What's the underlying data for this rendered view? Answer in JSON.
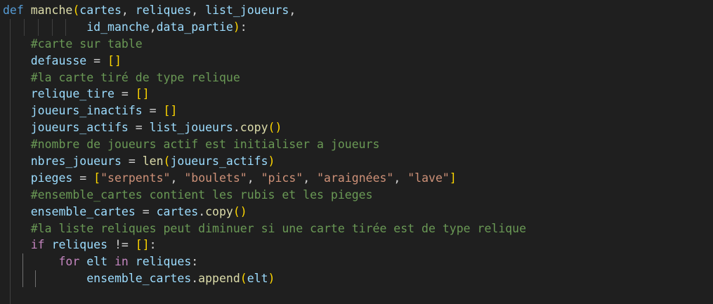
{
  "editor": {
    "background": "#1f1f1f",
    "colors": {
      "keyword_def": "#569cd6",
      "keyword_control": "#c586c0",
      "function": "#dcdcaa",
      "variable": "#9cdcfe",
      "comment": "#6a9955",
      "string": "#ce9178",
      "bracket_level1": "#ffd700",
      "bracket_level2": "#da70d6",
      "plain": "#d4d4d4"
    },
    "lines": [
      {
        "tokens": [
          [
            "kw-def",
            "def"
          ],
          [
            "plain",
            " "
          ],
          [
            "fn",
            "manche"
          ],
          [
            "b1",
            "("
          ],
          [
            "param",
            "cartes"
          ],
          [
            "plain",
            ", "
          ],
          [
            "param",
            "reliques"
          ],
          [
            "plain",
            ", "
          ],
          [
            "param",
            "list_joueurs"
          ],
          [
            "plain",
            ","
          ]
        ]
      },
      {
        "tokens": [
          [
            "plain",
            "            "
          ],
          [
            "param",
            "id_manche"
          ],
          [
            "plain",
            ","
          ],
          [
            "param",
            "data_partie"
          ],
          [
            "b1",
            ")"
          ],
          [
            "plain",
            ":"
          ]
        ]
      },
      {
        "tokens": [
          [
            "plain",
            "    "
          ],
          [
            "cmt",
            "#carte sur table"
          ]
        ]
      },
      {
        "tokens": [
          [
            "plain",
            "    "
          ],
          [
            "var",
            "defausse"
          ],
          [
            "plain",
            " = "
          ],
          [
            "b1",
            "[]"
          ]
        ]
      },
      {
        "tokens": [
          [
            "plain",
            "    "
          ],
          [
            "cmt",
            "#la carte tiré de type relique"
          ]
        ]
      },
      {
        "tokens": [
          [
            "plain",
            "    "
          ],
          [
            "var",
            "relique_tire"
          ],
          [
            "plain",
            " = "
          ],
          [
            "b1",
            "[]"
          ]
        ]
      },
      {
        "tokens": [
          [
            "plain",
            "    "
          ],
          [
            "var",
            "joueurs_inactifs"
          ],
          [
            "plain",
            " = "
          ],
          [
            "b1",
            "[]"
          ]
        ]
      },
      {
        "tokens": [
          [
            "plain",
            "    "
          ],
          [
            "var",
            "joueurs_actifs"
          ],
          [
            "plain",
            " = "
          ],
          [
            "var",
            "list_joueurs"
          ],
          [
            "plain",
            "."
          ],
          [
            "fn",
            "copy"
          ],
          [
            "b1",
            "()"
          ]
        ]
      },
      {
        "tokens": [
          [
            "plain",
            "    "
          ],
          [
            "cmt",
            "#nombre de joueurs actif est initialiser a joueurs"
          ]
        ]
      },
      {
        "tokens": [
          [
            "plain",
            "    "
          ],
          [
            "var",
            "nbres_joueurs"
          ],
          [
            "plain",
            " = "
          ],
          [
            "fn",
            "len"
          ],
          [
            "b1",
            "("
          ],
          [
            "var",
            "joueurs_actifs"
          ],
          [
            "b1",
            ")"
          ]
        ]
      },
      {
        "tokens": [
          [
            "plain",
            "    "
          ],
          [
            "var",
            "pieges"
          ],
          [
            "plain",
            " = "
          ],
          [
            "b1",
            "["
          ],
          [
            "str",
            "\"serpents\""
          ],
          [
            "plain",
            ", "
          ],
          [
            "str",
            "\"boulets\""
          ],
          [
            "plain",
            ", "
          ],
          [
            "str",
            "\"pics\""
          ],
          [
            "plain",
            ", "
          ],
          [
            "str",
            "\"araignées\""
          ],
          [
            "plain",
            ", "
          ],
          [
            "str",
            "\"lave\""
          ],
          [
            "b1",
            "]"
          ]
        ]
      },
      {
        "tokens": [
          [
            "plain",
            "    "
          ],
          [
            "cmt",
            "#ensemble_cartes contient les rubis et les pieges"
          ]
        ]
      },
      {
        "tokens": [
          [
            "plain",
            "    "
          ],
          [
            "var",
            "ensemble_cartes"
          ],
          [
            "plain",
            " = "
          ],
          [
            "var",
            "cartes"
          ],
          [
            "plain",
            "."
          ],
          [
            "fn",
            "copy"
          ],
          [
            "b1",
            "()"
          ]
        ]
      },
      {
        "tokens": [
          [
            "plain",
            "    "
          ],
          [
            "cmt",
            "#la liste reliques peut diminuer si une carte tirée est de type relique"
          ]
        ]
      },
      {
        "tokens": [
          [
            "plain",
            "    "
          ],
          [
            "kw-ctrl",
            "if"
          ],
          [
            "plain",
            " "
          ],
          [
            "var",
            "reliques"
          ],
          [
            "plain",
            " != "
          ],
          [
            "b1",
            "[]"
          ],
          [
            "plain",
            ":"
          ]
        ]
      },
      {
        "tokens": [
          [
            "plain",
            "        "
          ],
          [
            "kw-ctrl",
            "for"
          ],
          [
            "plain",
            " "
          ],
          [
            "var",
            "elt"
          ],
          [
            "plain",
            " "
          ],
          [
            "kw-ctrl",
            "in"
          ],
          [
            "plain",
            " "
          ],
          [
            "var",
            "reliques"
          ],
          [
            "plain",
            ":"
          ]
        ]
      },
      {
        "tokens": [
          [
            "plain",
            "            "
          ],
          [
            "var",
            "ensemble_cartes"
          ],
          [
            "plain",
            "."
          ],
          [
            "fn",
            "append"
          ],
          [
            "b1",
            "("
          ],
          [
            "var",
            "elt"
          ],
          [
            "b1",
            ")"
          ]
        ]
      },
      {
        "tokens": []
      }
    ]
  }
}
